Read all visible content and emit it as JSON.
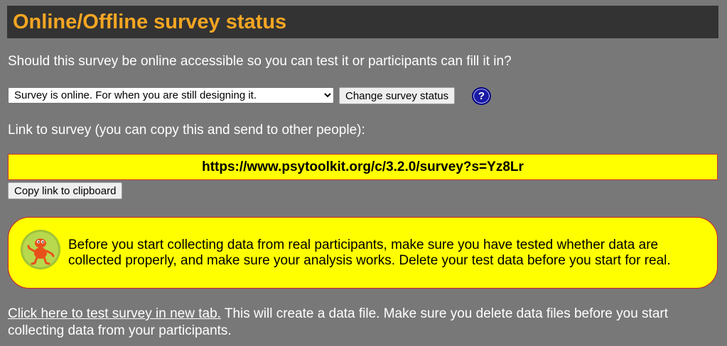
{
  "header": {
    "title": "Online/Offline survey status"
  },
  "question": "Should this survey be online accessible so you can test it or participants can fill it in?",
  "status_select": {
    "selected": "Survey is online. For when you are still designing it."
  },
  "change_status_button": "Change survey status",
  "help_icon": {
    "icon": "question-mark-icon",
    "glyph": "?"
  },
  "link_label": "Link to survey (you can copy this and send to other people):",
  "survey_link": "https://www.psytoolkit.org/c/3.2.0/survey?s=Yz8Lr",
  "copy_button": "Copy link to clipboard",
  "notice": {
    "icon": "mascot-icon",
    "text": "Before you start collecting data from real participants, make sure you have tested whether data are collected properly, and make sure your analysis works. Delete your test data before you start for real."
  },
  "footer": {
    "link_text": "Click here to test survey in new tab.",
    "text": " This will create a data file. Make sure you delete data files before you start collecting data from your participants."
  },
  "colors": {
    "background": "#787878",
    "title_bar": "#333333",
    "title_text": "#f5a623",
    "highlight": "#ffff00",
    "border_red": "#cc3333"
  }
}
